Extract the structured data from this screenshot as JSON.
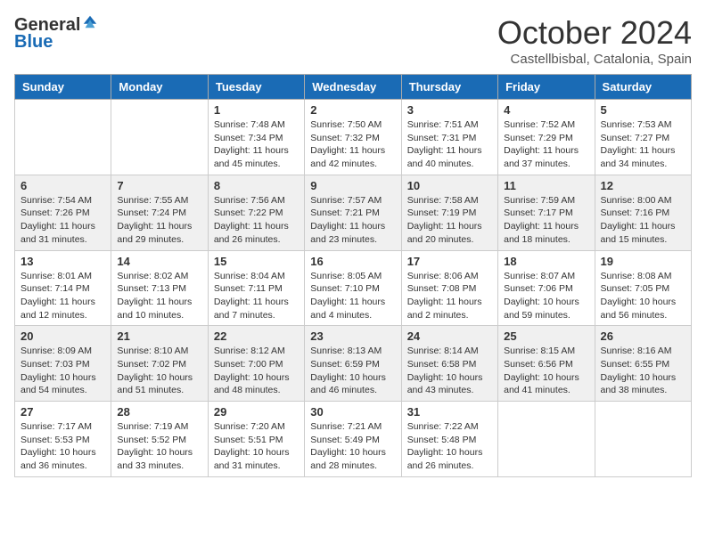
{
  "header": {
    "logo_general": "General",
    "logo_blue": "Blue",
    "month_title": "October 2024",
    "location": "Castellbisbal, Catalonia, Spain"
  },
  "days_of_week": [
    "Sunday",
    "Monday",
    "Tuesday",
    "Wednesday",
    "Thursday",
    "Friday",
    "Saturday"
  ],
  "weeks": [
    [
      {
        "day": "",
        "info": ""
      },
      {
        "day": "",
        "info": ""
      },
      {
        "day": "1",
        "info": "Sunrise: 7:48 AM\nSunset: 7:34 PM\nDaylight: 11 hours and 45 minutes."
      },
      {
        "day": "2",
        "info": "Sunrise: 7:50 AM\nSunset: 7:32 PM\nDaylight: 11 hours and 42 minutes."
      },
      {
        "day": "3",
        "info": "Sunrise: 7:51 AM\nSunset: 7:31 PM\nDaylight: 11 hours and 40 minutes."
      },
      {
        "day": "4",
        "info": "Sunrise: 7:52 AM\nSunset: 7:29 PM\nDaylight: 11 hours and 37 minutes."
      },
      {
        "day": "5",
        "info": "Sunrise: 7:53 AM\nSunset: 7:27 PM\nDaylight: 11 hours and 34 minutes."
      }
    ],
    [
      {
        "day": "6",
        "info": "Sunrise: 7:54 AM\nSunset: 7:26 PM\nDaylight: 11 hours and 31 minutes."
      },
      {
        "day": "7",
        "info": "Sunrise: 7:55 AM\nSunset: 7:24 PM\nDaylight: 11 hours and 29 minutes."
      },
      {
        "day": "8",
        "info": "Sunrise: 7:56 AM\nSunset: 7:22 PM\nDaylight: 11 hours and 26 minutes."
      },
      {
        "day": "9",
        "info": "Sunrise: 7:57 AM\nSunset: 7:21 PM\nDaylight: 11 hours and 23 minutes."
      },
      {
        "day": "10",
        "info": "Sunrise: 7:58 AM\nSunset: 7:19 PM\nDaylight: 11 hours and 20 minutes."
      },
      {
        "day": "11",
        "info": "Sunrise: 7:59 AM\nSunset: 7:17 PM\nDaylight: 11 hours and 18 minutes."
      },
      {
        "day": "12",
        "info": "Sunrise: 8:00 AM\nSunset: 7:16 PM\nDaylight: 11 hours and 15 minutes."
      }
    ],
    [
      {
        "day": "13",
        "info": "Sunrise: 8:01 AM\nSunset: 7:14 PM\nDaylight: 11 hours and 12 minutes."
      },
      {
        "day": "14",
        "info": "Sunrise: 8:02 AM\nSunset: 7:13 PM\nDaylight: 11 hours and 10 minutes."
      },
      {
        "day": "15",
        "info": "Sunrise: 8:04 AM\nSunset: 7:11 PM\nDaylight: 11 hours and 7 minutes."
      },
      {
        "day": "16",
        "info": "Sunrise: 8:05 AM\nSunset: 7:10 PM\nDaylight: 11 hours and 4 minutes."
      },
      {
        "day": "17",
        "info": "Sunrise: 8:06 AM\nSunset: 7:08 PM\nDaylight: 11 hours and 2 minutes."
      },
      {
        "day": "18",
        "info": "Sunrise: 8:07 AM\nSunset: 7:06 PM\nDaylight: 10 hours and 59 minutes."
      },
      {
        "day": "19",
        "info": "Sunrise: 8:08 AM\nSunset: 7:05 PM\nDaylight: 10 hours and 56 minutes."
      }
    ],
    [
      {
        "day": "20",
        "info": "Sunrise: 8:09 AM\nSunset: 7:03 PM\nDaylight: 10 hours and 54 minutes."
      },
      {
        "day": "21",
        "info": "Sunrise: 8:10 AM\nSunset: 7:02 PM\nDaylight: 10 hours and 51 minutes."
      },
      {
        "day": "22",
        "info": "Sunrise: 8:12 AM\nSunset: 7:00 PM\nDaylight: 10 hours and 48 minutes."
      },
      {
        "day": "23",
        "info": "Sunrise: 8:13 AM\nSunset: 6:59 PM\nDaylight: 10 hours and 46 minutes."
      },
      {
        "day": "24",
        "info": "Sunrise: 8:14 AM\nSunset: 6:58 PM\nDaylight: 10 hours and 43 minutes."
      },
      {
        "day": "25",
        "info": "Sunrise: 8:15 AM\nSunset: 6:56 PM\nDaylight: 10 hours and 41 minutes."
      },
      {
        "day": "26",
        "info": "Sunrise: 8:16 AM\nSunset: 6:55 PM\nDaylight: 10 hours and 38 minutes."
      }
    ],
    [
      {
        "day": "27",
        "info": "Sunrise: 7:17 AM\nSunset: 5:53 PM\nDaylight: 10 hours and 36 minutes."
      },
      {
        "day": "28",
        "info": "Sunrise: 7:19 AM\nSunset: 5:52 PM\nDaylight: 10 hours and 33 minutes."
      },
      {
        "day": "29",
        "info": "Sunrise: 7:20 AM\nSunset: 5:51 PM\nDaylight: 10 hours and 31 minutes."
      },
      {
        "day": "30",
        "info": "Sunrise: 7:21 AM\nSunset: 5:49 PM\nDaylight: 10 hours and 28 minutes."
      },
      {
        "day": "31",
        "info": "Sunrise: 7:22 AM\nSunset: 5:48 PM\nDaylight: 10 hours and 26 minutes."
      },
      {
        "day": "",
        "info": ""
      },
      {
        "day": "",
        "info": ""
      }
    ]
  ]
}
